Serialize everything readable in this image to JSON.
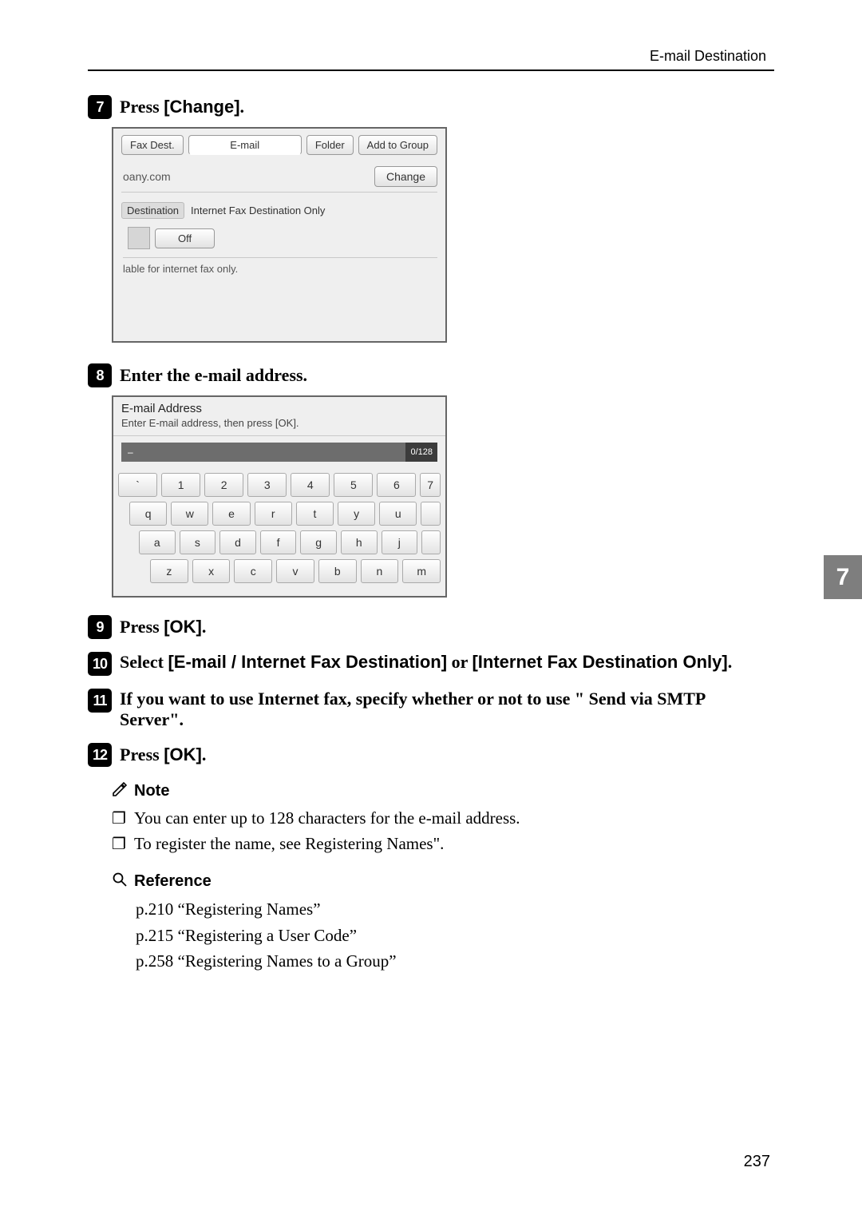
{
  "header": {
    "section": "E-mail Destination"
  },
  "side_tab": "7",
  "page_number": "237",
  "steps": {
    "s7": {
      "num": "7",
      "pre": "Press ",
      "btn": "[Change]",
      "post": "."
    },
    "s8": {
      "num": "8",
      "text": "Enter the e-mail address."
    },
    "s9": {
      "num": "9",
      "pre": "Press ",
      "btn": "[OK]",
      "post": "."
    },
    "s10": {
      "num": "10",
      "pre": "Select ",
      "btn1": "[E-mail / Internet Fax Destination]",
      "mid": " or ",
      "btn2": "[Internet Fax Destination Only]",
      "post": "."
    },
    "s11": {
      "num": "11",
      "text": "If you want to use Internet fax, specify whether or not to use \" Send via SMTP Server\"."
    },
    "s12": {
      "num": "12",
      "pre": "Press ",
      "btn": "[OK]",
      "post": "."
    }
  },
  "shot1": {
    "tabs": {
      "fax": "Fax Dest.",
      "email": "E-mail",
      "folder": "Folder",
      "group": "Add to Group"
    },
    "addr_text": "oany.com",
    "change": "Change",
    "dest_label": "Destination",
    "dest_text": "Internet Fax Destination Only",
    "off": "Off",
    "footnote": "lable for internet fax only."
  },
  "shot2": {
    "title": "E-mail Address",
    "subtitle": "Enter E-mail address, then press [OK].",
    "cursor": "–",
    "counter": "0/128",
    "row_num": {
      "k0": "`",
      "k1": "1",
      "k2": "2",
      "k3": "3",
      "k4": "4",
      "k5": "5",
      "k6": "6",
      "k7": "7"
    },
    "row_a": {
      "k0": "q",
      "k1": "w",
      "k2": "e",
      "k3": "r",
      "k4": "t",
      "k5": "y",
      "k6": "u"
    },
    "row_b": {
      "k0": "a",
      "k1": "s",
      "k2": "d",
      "k3": "f",
      "k4": "g",
      "k5": "h",
      "k6": "j"
    },
    "row_c": {
      "k0": "z",
      "k1": "x",
      "k2": "c",
      "k3": "v",
      "k4": "b",
      "k5": "n",
      "k6": "m"
    }
  },
  "note": {
    "heading": "Note",
    "b1": "You can enter up to 128 characters for the e-mail address.",
    "b2": "To register the name, see Registering Names\"."
  },
  "reference": {
    "heading": "Reference",
    "r1": "p.210 “Registering Names”",
    "r2": "p.215 “Registering a User Code”",
    "r3": "p.258 “Registering Names to a Group”"
  }
}
